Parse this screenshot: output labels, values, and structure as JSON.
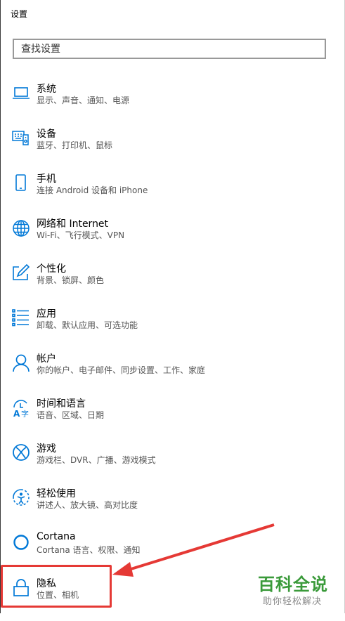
{
  "window": {
    "title": "设置"
  },
  "search": {
    "placeholder": "查找设置"
  },
  "items": [
    {
      "label": "系统",
      "desc": "显示、声音、通知、电源",
      "icon": "laptop-icon"
    },
    {
      "label": "设备",
      "desc": "蓝牙、打印机、鼠标",
      "icon": "devices-icon"
    },
    {
      "label": "手机",
      "desc": "连接 Android 设备和 iPhone",
      "icon": "phone-icon"
    },
    {
      "label": "网络和 Internet",
      "desc": "Wi-Fi、飞行模式、VPN",
      "icon": "globe-icon"
    },
    {
      "label": "个性化",
      "desc": "背景、锁屏、颜色",
      "icon": "personalization-icon"
    },
    {
      "label": "应用",
      "desc": "卸载、默认应用、可选功能",
      "icon": "apps-list-icon"
    },
    {
      "label": "帐户",
      "desc": "你的帐户、电子邮件、同步设置、工作、家庭",
      "icon": "person-icon"
    },
    {
      "label": "时间和语言",
      "desc": "语音、区域、日期",
      "icon": "time-language-icon"
    },
    {
      "label": "游戏",
      "desc": "游戏栏、DVR、广播、游戏模式",
      "icon": "xbox-icon"
    },
    {
      "label": "轻松使用",
      "desc": "讲述人、放大镜、高对比度",
      "icon": "ease-of-access-icon"
    },
    {
      "label": "Cortana",
      "desc": "Cortana 语言、权限、通知",
      "icon": "cortana-icon"
    },
    {
      "label": "隐私",
      "desc": "位置、相机",
      "icon": "lock-icon"
    }
  ],
  "watermark": {
    "main": "百科全说",
    "sub": "助你轻松解决"
  },
  "colors": {
    "accent": "#0078d7",
    "highlight": "#e53935",
    "watermark": "#3a9a3a"
  }
}
